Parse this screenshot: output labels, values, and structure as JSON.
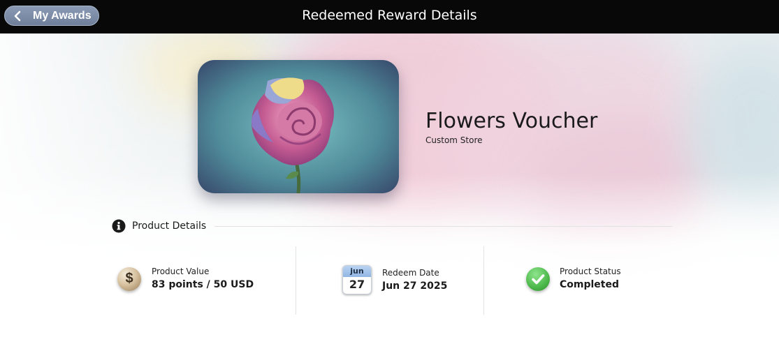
{
  "header": {
    "back_label": "My Awards",
    "title": "Redeemed Reward Details"
  },
  "product": {
    "name": "Flowers Voucher",
    "store": "Custom Store"
  },
  "section": {
    "title": "Product Details"
  },
  "details": {
    "value": {
      "label": "Product Value",
      "value": "83 points / 50 USD",
      "icon": "dollar-coin-icon"
    },
    "redeem": {
      "label": "Redeem Date",
      "value": "Jun 27 2025",
      "icon_month": "jun",
      "icon_day": "27"
    },
    "status": {
      "label": "Product Status",
      "value": "Completed",
      "icon": "green-check-icon",
      "color": "#4cb84a"
    }
  },
  "colors": {
    "topbar": "#080808",
    "back_button": "#7f8fab"
  }
}
